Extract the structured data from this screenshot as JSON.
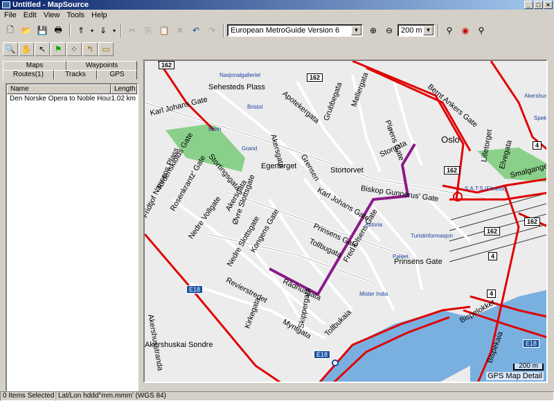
{
  "window": {
    "title": "Untitled - MapSource",
    "minimize": "_",
    "maximize": "□",
    "close": "×"
  },
  "menu": [
    "File",
    "Edit",
    "View",
    "Tools",
    "Help"
  ],
  "toolbar": {
    "map_product": "European MetroGuide Version 6",
    "zoom_value": "200 m"
  },
  "left_tabs": {
    "row1": [
      "Maps",
      "Waypoints"
    ],
    "row2": [
      "Routes(1)",
      "Tracks",
      "GPS"
    ]
  },
  "routes_list": {
    "columns": [
      "Name",
      "Length"
    ],
    "rows": [
      {
        "name": "Den Norske Opera to Noble House",
        "length": "1.02 km"
      }
    ]
  },
  "map": {
    "city_label": "Oslo",
    "streets": [
      "Karl Johans Gate",
      "Sehesteds Plass",
      "Apotekergata",
      "Grubbegata",
      "Møllergata",
      "Pløens Gate",
      "Bernt Ankers Gate",
      "Akersgata",
      "Grensen",
      "Storgata",
      "Lilletorget",
      "Elvegata",
      "Smalgangen",
      "Biskop Gunnerus' Gate",
      "Karl Johans Gate",
      "Egertorget",
      "Stortorvet",
      "Prinsens Gate",
      "Tollbugata",
      "Fred Olsens Gate",
      "Prinsens Gate",
      "Kongens Gate",
      "Nedre Slottsgate",
      "Øvre Slottsgate",
      "Nedre Vollgate",
      "Akersgata",
      "Rosenkrantz' Gate",
      "Tordenskiolds Gate",
      "Fridtjof Nansens Plass",
      "Stortingsgata",
      "Rådhusgata",
      "Revierstredet",
      "Akershusstranda",
      "Kirkegata",
      "Myntgata",
      "Skippergata",
      "Tollbukaia",
      "Akershuskai Sondre",
      "Bispelokket",
      "Bispekaia",
      "Stranden",
      "Storgata",
      "Akersgata",
      "Strandgata",
      "Tollbukaia",
      "Smalgangen"
    ],
    "pois": [
      "Nasjonalgalleriet",
      "Bristol",
      "Blom",
      "Grand",
      "Astoria",
      "Turistinformasjon",
      "Paleet",
      "Mister India",
      "Spektr",
      "Akershus",
      "S.A.T.S (Fitness)"
    ],
    "shields": [
      "162",
      "162",
      "162",
      "162",
      "162",
      "4",
      "4",
      "4",
      "E18",
      "E18",
      "E18"
    ],
    "scale": "200 m",
    "detail_label": "GPS Map Detail"
  },
  "status": {
    "selected": "0 Items Selected",
    "latlon": "Lat/Lon hddd°mm.mmm' (WGS 84)"
  },
  "colors": {
    "route": "#8b1a8b",
    "main_road": "#e00000",
    "park": "#8ad08a",
    "water": "#7ab0e0"
  }
}
